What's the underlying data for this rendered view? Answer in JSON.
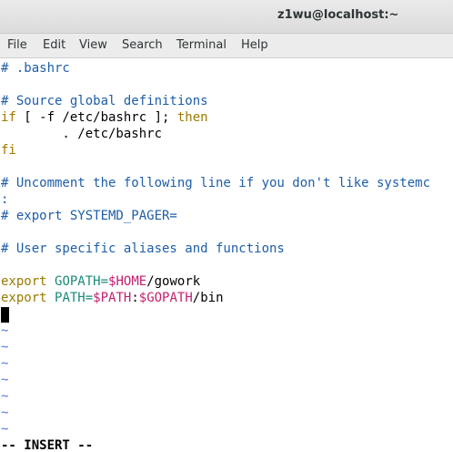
{
  "window": {
    "title": "z1wu@localhost:~"
  },
  "menubar": {
    "items": [
      "File",
      "Edit",
      "View",
      "Search",
      "Terminal",
      "Help"
    ]
  },
  "editor": {
    "lines": {
      "l1": "# .bashrc",
      "l3": "# Source global definitions",
      "l4_kw1": "if",
      "l4_mid": " [ -f /etc/bashrc ]; ",
      "l4_kw2": "then",
      "l5": "        . /etc/bashrc",
      "l6": "fi",
      "l8": "# Uncomment the following line if you don't like systemc",
      "l9": ":",
      "l10": "# export SYSTEMD_PAGER=",
      "l12": "# User specific aliases and functions",
      "l14_kw": "export",
      "l14_ident": "GOPATH=",
      "l14_var": "$HOME",
      "l14_rest": "/gowork",
      "l15_kw": "export",
      "l15_ident": "PATH=",
      "l15_var1": "$PATH",
      "l15_sep": ":",
      "l15_var2": "$GOPATH",
      "l15_rest": "/bin"
    },
    "tilde": "~",
    "mode": "-- INSERT --"
  },
  "colors": {
    "comment": "#1e5ea8",
    "keyword": "#9b7a00",
    "variable": "#c31f6e",
    "identifier": "#1b8a7a",
    "tilde": "#4f7be0"
  }
}
